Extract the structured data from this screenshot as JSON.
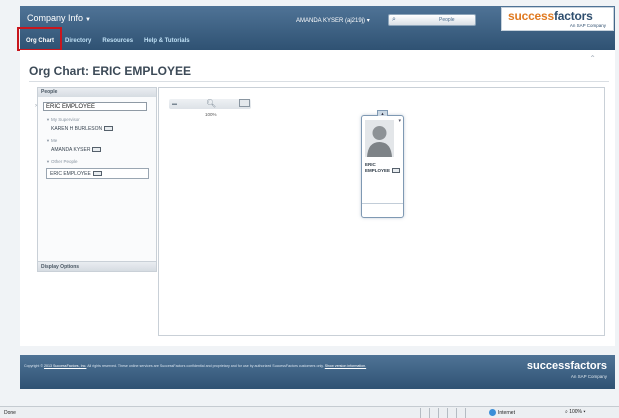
{
  "header": {
    "company_menu": "Company Info",
    "user_menu": "AMANDA KYSER (aj219j)",
    "search_placeholder": "People",
    "logo_main_a": "success",
    "logo_main_b": "factors",
    "logo_sub": "An SAP Company"
  },
  "tabs": [
    {
      "label": "Org Chart",
      "active": true
    },
    {
      "label": "Directory",
      "active": false
    },
    {
      "label": "Resources",
      "active": false
    },
    {
      "label": "Help & Tutorials",
      "active": false
    }
  ],
  "page": {
    "title": "Org Chart: ERIC EMPLOYEE"
  },
  "people_panel": {
    "heading": "People",
    "search_value": "ERIC EMPLOYEE",
    "supervisor_section": "My Supervisor",
    "supervisor": "KAREN H BURLESON",
    "me_section": "Me",
    "me": "AMANDA KYSER",
    "other_section": "Other People",
    "other": "ERIC EMPLOYEE",
    "footer": "Display Options"
  },
  "chart": {
    "zoom_level": "100%",
    "node_name_line1": "ERIC",
    "node_name_line2": "EMPLOYEE"
  },
  "footer": {
    "copyright_prefix": "Copyright ©",
    "copyright_link": "2013 SuccessFactors, Inc.",
    "copyright_text": "All rights reserved. These online services are SuccessFactors confidential and proprietary and for use by authorized SuccessFactors customers only.",
    "show_version": "Show version information.",
    "logo": "successfactors",
    "logo_sub": "An SAP Company"
  },
  "statusbar": {
    "left": "Done",
    "zone": "Internet",
    "zoom": "100%"
  },
  "colors": {
    "header_blue": "#3b5f82",
    "brand_orange": "#e07a21",
    "highlight_red": "#c8161d"
  }
}
